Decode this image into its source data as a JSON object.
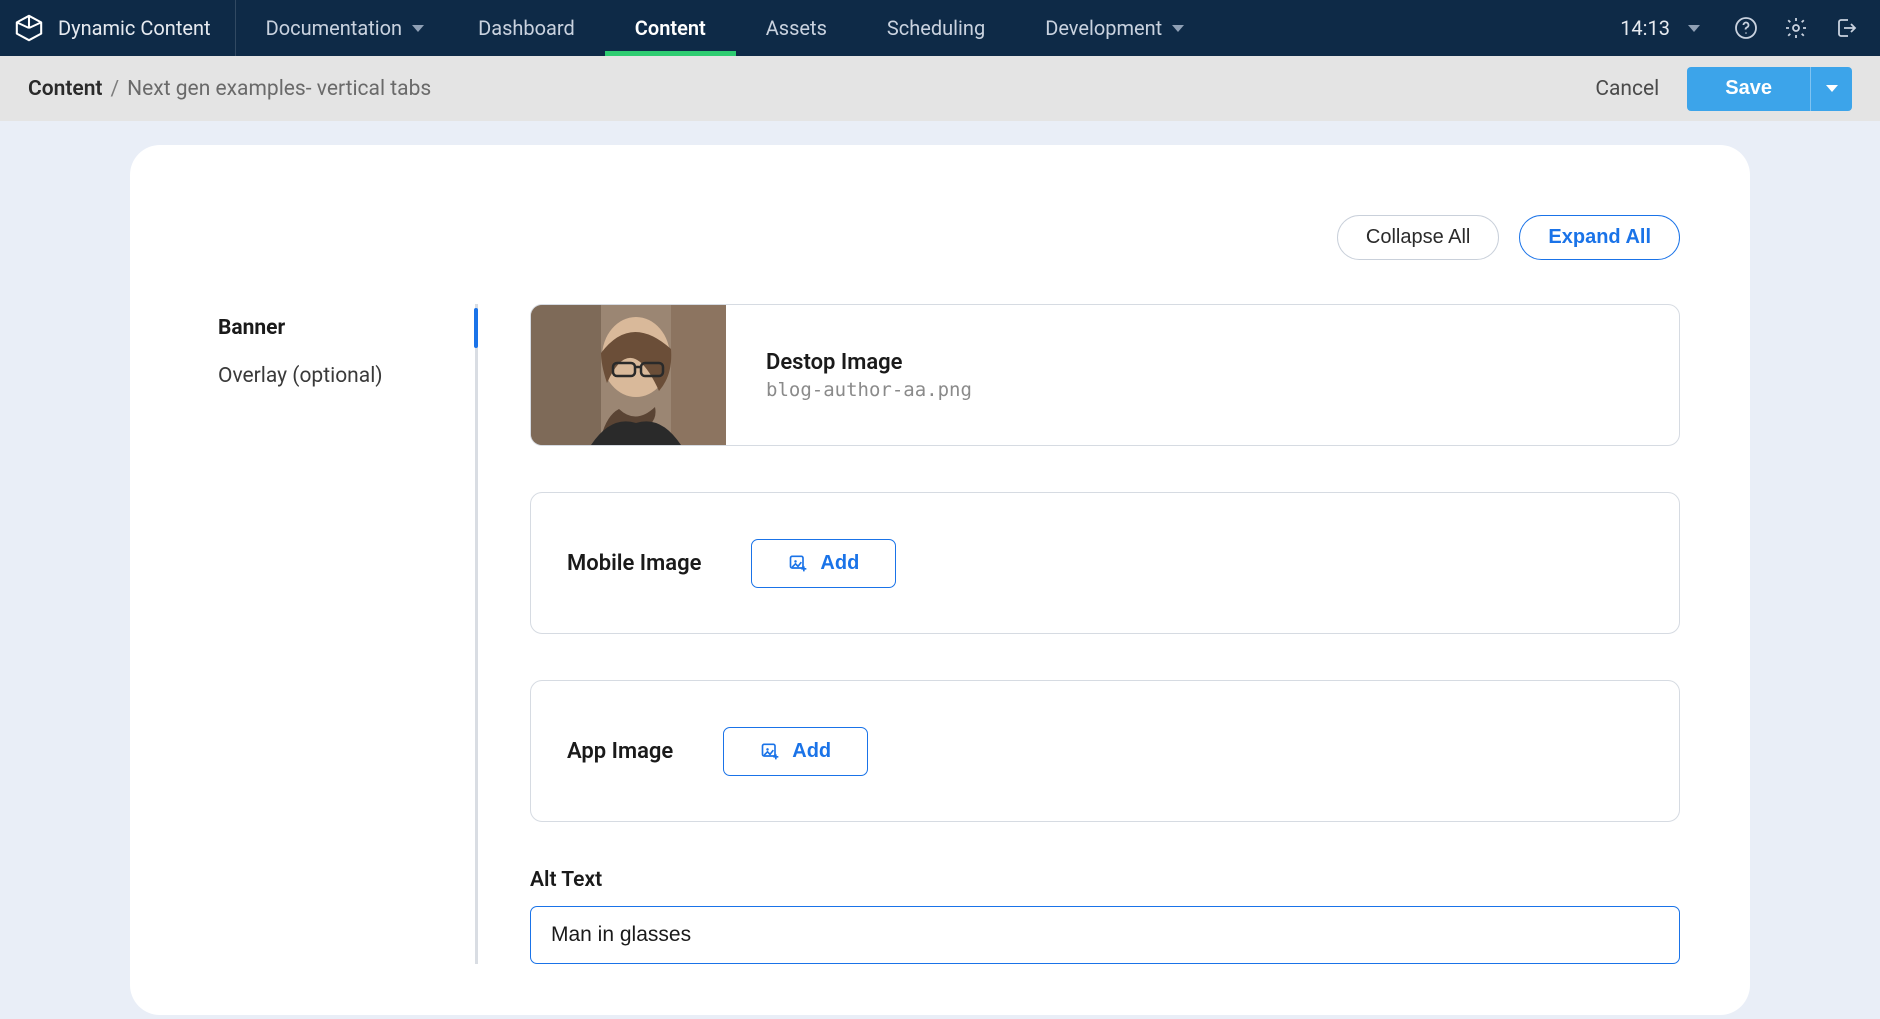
{
  "brand": {
    "name": "Dynamic Content"
  },
  "nav": {
    "doc_label": "Documentation",
    "items": [
      {
        "label": "Dashboard",
        "active": false
      },
      {
        "label": "Content",
        "active": true
      },
      {
        "label": "Assets",
        "active": false
      },
      {
        "label": "Scheduling",
        "active": false
      }
    ],
    "dev_label": "Development"
  },
  "clock": {
    "time": "14:13"
  },
  "breadcrumb": {
    "root": "Content",
    "leaf": "Next gen examples- vertical tabs"
  },
  "actions": {
    "cancel": "Cancel",
    "save": "Save"
  },
  "toolbar": {
    "collapse": "Collapse All",
    "expand": "Expand All"
  },
  "side_tabs": [
    {
      "label": "Banner",
      "active": true
    },
    {
      "label": "Overlay (optional)",
      "active": false
    }
  ],
  "fields": {
    "desktop_image": {
      "label": "Destop Image",
      "filename": "blog-author-aa.png"
    },
    "mobile_image": {
      "label": "Mobile Image",
      "add": "Add"
    },
    "app_image": {
      "label": "App Image",
      "add": "Add"
    },
    "alt_text": {
      "label": "Alt Text",
      "value": "Man in glasses"
    }
  }
}
